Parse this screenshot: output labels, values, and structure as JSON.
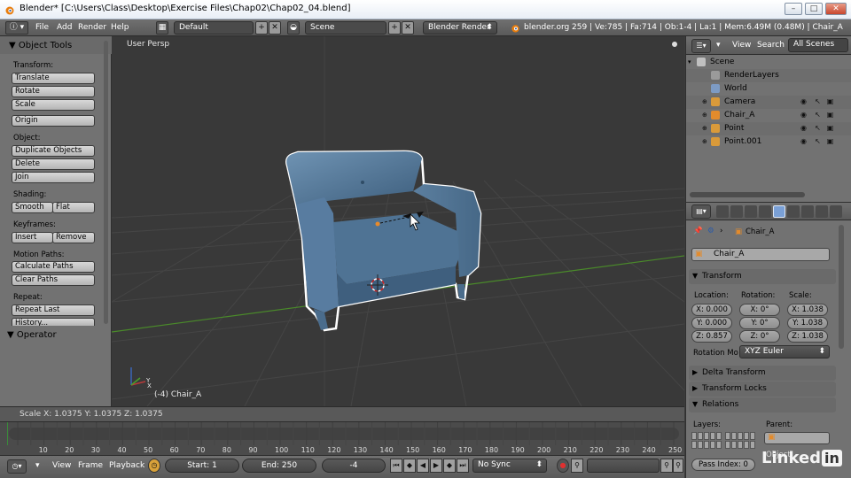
{
  "window": {
    "title": "Blender* [C:\\Users\\Class\\Desktop\\Exercise Files\\Chap02\\Chap02_04.blend]",
    "minimize": "–",
    "maximize": "□",
    "close": "✕"
  },
  "info_header": {
    "menus": [
      "File",
      "Add",
      "Render",
      "Help"
    ],
    "screen_layout": "Default",
    "scene": "Scene",
    "render_engine": "Blender Render",
    "stats": "blender.org 259 | Ve:785 | Fa:714 | Ob:1-4 | La:1 | Mem:6.49M (0.48M) | Chair_A"
  },
  "tool_shelf": {
    "title": "Object Tools",
    "sections": {
      "transform": "Transform:",
      "object": "Object:",
      "shading": "Shading:",
      "keyframes": "Keyframes:",
      "motion_paths": "Motion Paths:",
      "repeat": "Repeat:"
    },
    "buttons": {
      "translate": "Translate",
      "rotate": "Rotate",
      "scale": "Scale",
      "origin": "Origin",
      "duplicate": "Duplicate Objects",
      "delete": "Delete",
      "join": "Join",
      "smooth": "Smooth",
      "flat": "Flat",
      "insert": "Insert",
      "remove": "Remove",
      "calc_paths": "Calculate Paths",
      "clear_paths": "Clear Paths",
      "repeat_last": "Repeat Last",
      "history": "History..."
    }
  },
  "operator_panel": {
    "title": "Operator"
  },
  "viewport": {
    "view_label": "User Persp",
    "object_label": "(-4) Chair_A",
    "axis_x": "X",
    "axis_y": "Y"
  },
  "status": {
    "scale_text": "Scale X: 1.0375  Y: 1.0375  Z: 1.0375"
  },
  "timeline": {
    "ticks": [
      10,
      20,
      30,
      40,
      50,
      60,
      70,
      80,
      90,
      100,
      110,
      120,
      130,
      140,
      150,
      160,
      170,
      180,
      190,
      200,
      210,
      220,
      230,
      240,
      250
    ],
    "menus": [
      "View",
      "Frame",
      "Playback"
    ],
    "start": "Start: 1",
    "end": "End: 250",
    "current": "-4",
    "sync": "No Sync"
  },
  "outliner": {
    "header": {
      "view": "View",
      "search": "Search",
      "filter": "All Scenes"
    },
    "items": [
      {
        "name": "Scene",
        "color": "#c0c0c0"
      },
      {
        "name": "RenderLayers",
        "color": "#9a9a9a"
      },
      {
        "name": "World",
        "color": "#7d9bc4"
      },
      {
        "name": "Camera",
        "color": "#d99a3a"
      },
      {
        "name": "Chair_A",
        "color": "#e38b2c"
      },
      {
        "name": "Point",
        "color": "#d99a3a"
      },
      {
        "name": "Point.001",
        "color": "#d99a3a"
      }
    ]
  },
  "properties": {
    "breadcrumb": "Chair_A",
    "object_name": "Chair_A",
    "transform": {
      "title": "Transform",
      "location_label": "Location:",
      "rotation_label": "Rotation:",
      "scale_label": "Scale:",
      "location": [
        "X: 0.000",
        "Y: 0.000",
        "Z: 0.857"
      ],
      "rotation": [
        "X: 0°",
        "Y: 0°",
        "Z: 0°"
      ],
      "scale": [
        "X: 1.038",
        "Y: 1.038",
        "Z: 1.038"
      ],
      "rotation_mode_label": "Rotation Mo",
      "rotation_mode": "XYZ Euler"
    },
    "delta_transform": "Delta Transform",
    "transform_locks": "Transform Locks",
    "relations": {
      "title": "Relations",
      "layers_label": "Layers:",
      "parent_label": "Parent:",
      "pass_index": "Pass Index: 0",
      "object_label": "Object"
    }
  },
  "watermark": {
    "text": "Linked",
    "suffix": "in"
  },
  "colors": {
    "panel_gray": "#727272",
    "viewport_bg": "#393939",
    "chair_blue": "#4f7394",
    "selection_outline": "#ffffff",
    "x_axis": "#8a3535",
    "y_axis": "#4a8a2a"
  }
}
